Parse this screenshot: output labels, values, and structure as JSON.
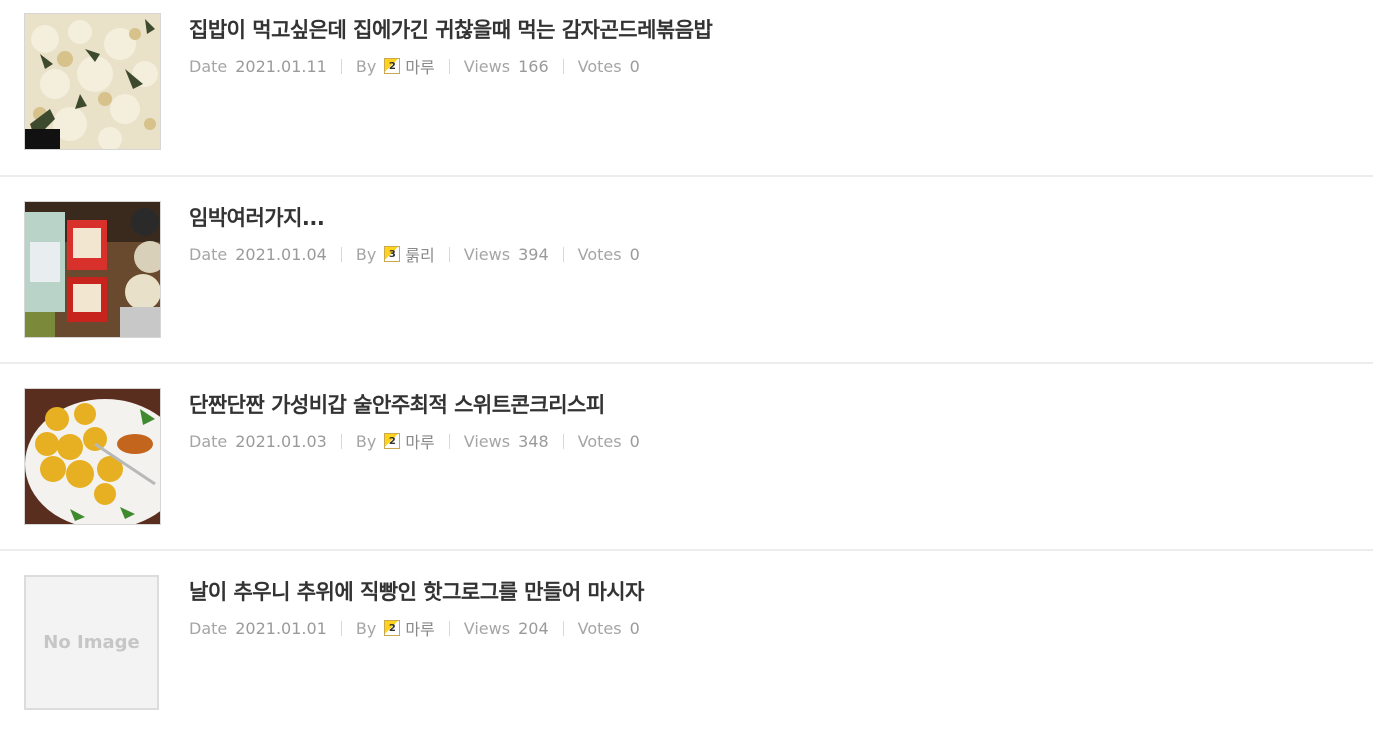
{
  "posts": [
    {
      "title": "집밥이 먹고싶은데 집에가긴 귀찮을때 먹는 감자곤드레볶음밥",
      "date_label": "Date",
      "date": "2021.01.11",
      "by_label": "By",
      "author_level": "2",
      "author": "마루",
      "views_label": "Views",
      "views": "166",
      "votes_label": "Votes",
      "votes": "0",
      "thumb": "rice-photo"
    },
    {
      "title": "임박여러가지...",
      "date_label": "Date",
      "date": "2021.01.04",
      "by_label": "By",
      "author_level": "3",
      "author": "룱리",
      "views_label": "Views",
      "views": "394",
      "votes_label": "Votes",
      "votes": "0",
      "thumb": "packages-photo"
    },
    {
      "title": "단짠단짠 가성비갑 술안주최적 스위트콘크리스피",
      "date_label": "Date",
      "date": "2021.01.03",
      "by_label": "By",
      "author_level": "2",
      "author": "마루",
      "views_label": "Views",
      "views": "348",
      "votes_label": "Votes",
      "votes": "0",
      "thumb": "fried-snack-photo"
    },
    {
      "title": "날이 추우니 추위에 직빵인 핫그로그를 만들어 마시자",
      "date_label": "Date",
      "date": "2021.01.01",
      "by_label": "By",
      "author_level": "2",
      "author": "마루",
      "views_label": "Views",
      "views": "204",
      "votes_label": "Votes",
      "votes": "0",
      "thumb_text": "No Image"
    }
  ],
  "colors": {
    "title": "#333333",
    "meta": "#999999",
    "divider": "#ececec",
    "level_badge": "#ffd21e"
  }
}
